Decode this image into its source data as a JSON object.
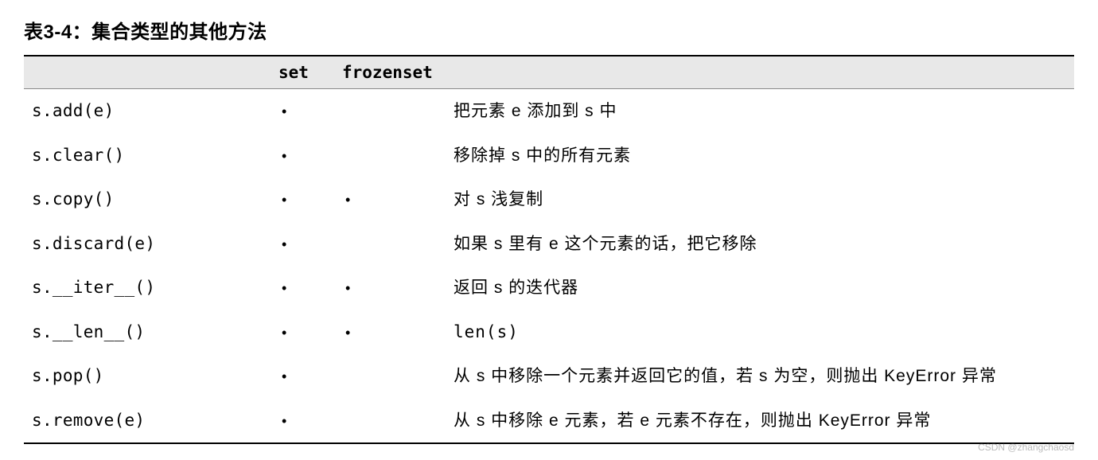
{
  "caption": "表3-4：集合类型的其他方法",
  "headers": {
    "method": "",
    "set": "set",
    "frozenset": "frozenset",
    "desc": ""
  },
  "dot": "•",
  "rows": [
    {
      "method": "s.add(e)",
      "set": true,
      "frozenset": false,
      "desc": "把元素 e 添加到 s 中"
    },
    {
      "method": "s.clear()",
      "set": true,
      "frozenset": false,
      "desc": "移除掉 s 中的所有元素"
    },
    {
      "method": "s.copy()",
      "set": true,
      "frozenset": true,
      "desc": "对 s 浅复制"
    },
    {
      "method": "s.discard(e)",
      "set": true,
      "frozenset": false,
      "desc": "如果 s 里有 e 这个元素的话，把它移除"
    },
    {
      "method": "s.__iter__()",
      "set": true,
      "frozenset": true,
      "desc": "返回 s 的迭代器"
    },
    {
      "method": "s.__len__()",
      "set": true,
      "frozenset": true,
      "desc": "len(s)",
      "desc_mono": true
    },
    {
      "method": "s.pop()",
      "set": true,
      "frozenset": false,
      "desc": "从 s 中移除一个元素并返回它的值，若 s 为空，则抛出 KeyError 异常"
    },
    {
      "method": "s.remove(e)",
      "set": true,
      "frozenset": false,
      "desc": "从 s 中移除 e 元素，若 e 元素不存在，则抛出 KeyError 异常"
    }
  ],
  "watermark": "CSDN @zhangchaosd"
}
